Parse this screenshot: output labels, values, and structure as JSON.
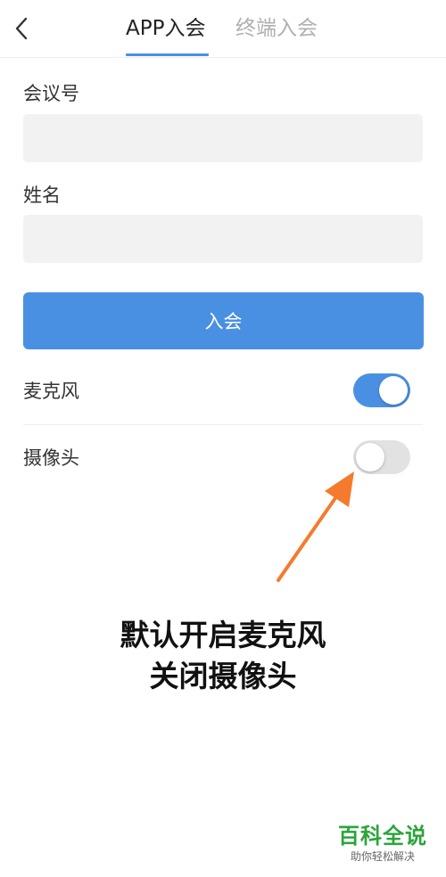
{
  "header": {
    "back_icon": "chevron-left-icon",
    "tabs": [
      {
        "label": "APP入会",
        "active": true
      },
      {
        "label": "终端入会",
        "active": false
      }
    ]
  },
  "form": {
    "meeting_id": {
      "label": "会议号",
      "value": "",
      "placeholder": ""
    },
    "name": {
      "label": "姓名",
      "value": "",
      "placeholder": ""
    },
    "join_label": "入会"
  },
  "settings": {
    "microphone": {
      "label": "麦克风",
      "on": true
    },
    "camera": {
      "label": "摄像头",
      "on": false
    }
  },
  "annotation": {
    "line1": "默认开启麦克风",
    "line2": "关闭摄像头",
    "arrow_color": "#f47b2e"
  },
  "watermark": {
    "title": "百科全说",
    "subtitle": "助你轻松解决"
  },
  "colors": {
    "accent": "#4a90e2",
    "toggle_off": "#e2e2e2",
    "input_bg": "#f2f2f2"
  }
}
